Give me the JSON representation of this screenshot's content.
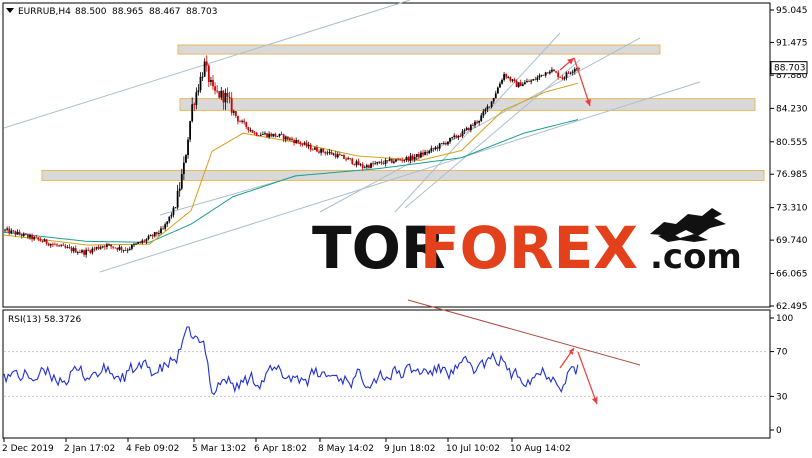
{
  "chart_data": [
    {
      "type": "candlestick",
      "header": {
        "symbol": "EURRUB,H4",
        "open": "88.500",
        "high": "88.965",
        "low": "88.467",
        "close": "88.703"
      },
      "current_price_label": "88.703",
      "y_ticks": [
        "95.045",
        "91.475",
        "87.880",
        "84.230",
        "80.555",
        "76.985",
        "73.310",
        "69.740",
        "66.065",
        "62.495"
      ],
      "ylim": [
        62.495,
        95.045
      ],
      "x_ticks": [
        "2 Dec 2019",
        "2 Jan 17:02",
        "4 Feb 09:02",
        "5 Mar 13:02",
        "6 Apr 18:02",
        "8 May 14:02",
        "9 Jun 18:02",
        "10 Jul 10:02",
        "10 Aug 14:02"
      ],
      "series_anchor_close": [
        [
          0,
          70.8
        ],
        [
          10,
          70.2
        ],
        [
          20,
          69.5
        ],
        [
          28,
          68.9
        ],
        [
          38,
          68.4
        ],
        [
          48,
          69.2
        ],
        [
          58,
          68.7
        ],
        [
          68,
          69.8
        ],
        [
          76,
          70.9
        ],
        [
          82,
          73.5
        ],
        [
          86,
          77.8
        ],
        [
          90,
          84.5
        ],
        [
          94,
          87.5
        ],
        [
          96,
          89.0
        ],
        [
          100,
          86.0
        ],
        [
          106,
          85.5
        ],
        [
          112,
          83.0
        ],
        [
          120,
          81.5
        ],
        [
          132,
          81.2
        ],
        [
          140,
          80.6
        ],
        [
          148,
          79.8
        ],
        [
          158,
          79.2
        ],
        [
          166,
          78.5
        ],
        [
          172,
          77.8
        ],
        [
          180,
          78.2
        ],
        [
          188,
          78.5
        ],
        [
          196,
          78.8
        ],
        [
          204,
          79.5
        ],
        [
          212,
          80.5
        ],
        [
          220,
          81.5
        ],
        [
          228,
          83.0
        ],
        [
          234,
          85.0
        ],
        [
          240,
          88.0
        ],
        [
          246,
          86.8
        ],
        [
          254,
          87.3
        ],
        [
          262,
          88.5
        ],
        [
          268,
          87.6
        ],
        [
          274,
          88.7
        ]
      ],
      "ma_slow_anchor": [
        [
          0,
          70.6
        ],
        [
          40,
          69.6
        ],
        [
          70,
          69.5
        ],
        [
          90,
          71.5
        ],
        [
          110,
          74.5
        ],
        [
          140,
          76.8
        ],
        [
          180,
          77.6
        ],
        [
          220,
          78.8
        ],
        [
          250,
          81.5
        ],
        [
          276,
          83.0
        ]
      ],
      "ma_fast_anchor": [
        [
          0,
          70.3
        ],
        [
          40,
          69.2
        ],
        [
          70,
          69.3
        ],
        [
          90,
          73.0
        ],
        [
          100,
          79.5
        ],
        [
          115,
          81.5
        ],
        [
          140,
          80.5
        ],
        [
          170,
          79.0
        ],
        [
          200,
          78.5
        ],
        [
          220,
          79.6
        ],
        [
          240,
          84.0
        ],
        [
          260,
          86.0
        ],
        [
          276,
          87.0
        ]
      ],
      "resistance_zones": [
        {
          "top": 91.2,
          "bottom": 90.2
        },
        {
          "top": 85.3,
          "bottom": 84.0
        },
        {
          "top": 77.4,
          "bottom": 76.3
        }
      ],
      "colors": {
        "bull": "#000000",
        "bear": "#cc0000",
        "ma_slow": "#1a9e8f",
        "ma_fast": "#d4a017",
        "channel": "#a9bfd1",
        "zone_fill": "#d9d9d9",
        "zone_border": "#e9b95c",
        "arrow": "#ee3b3b"
      }
    },
    {
      "type": "line",
      "label": "RSI(13) 58.3726",
      "ylim": [
        0,
        100
      ],
      "y_ticks": [
        "100",
        "70",
        "30",
        "0"
      ],
      "levels": [
        70,
        30
      ],
      "line_color": "#1f2fd6",
      "trend_color": "#b04a3c"
    }
  ],
  "watermark": {
    "part1": "TOR",
    "part2": "FOREX",
    "part3": ".com",
    "logo": "bull-bear-icon"
  }
}
